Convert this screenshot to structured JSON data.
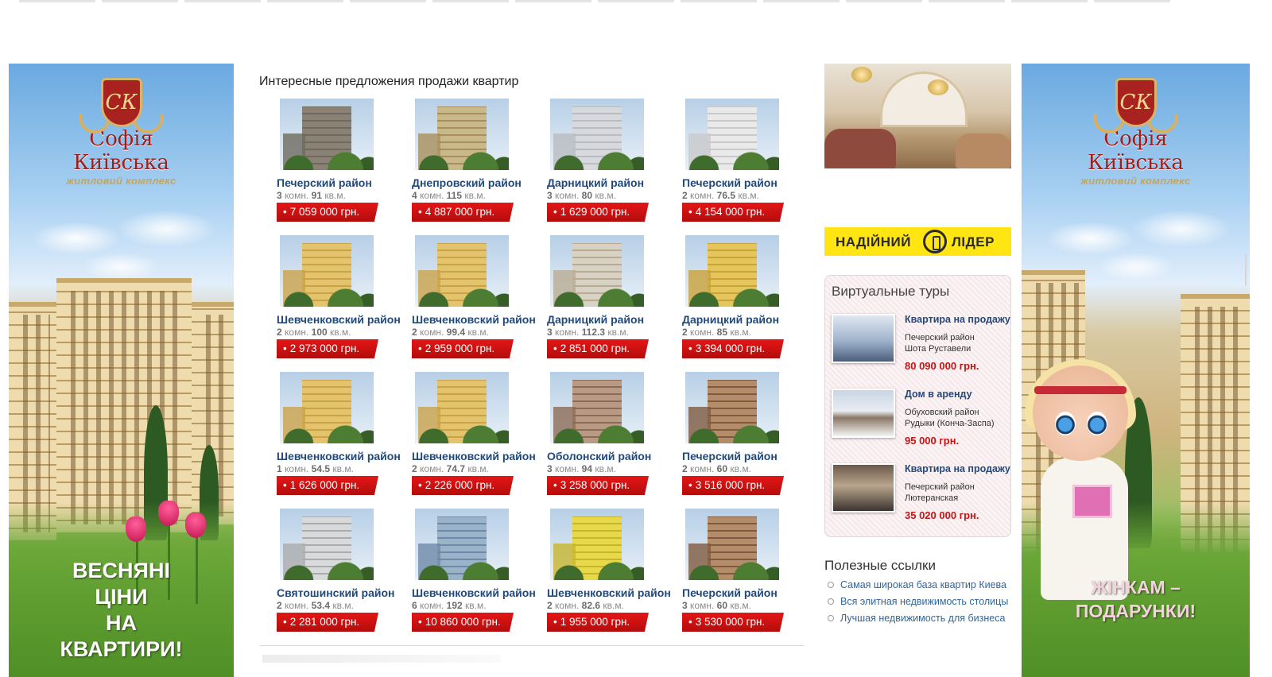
{
  "section_title": "Интересные предложения продажи квартир",
  "listings": [
    {
      "district": "Печерский район",
      "rooms": "3",
      "rooms_label": "комн.",
      "area": "91",
      "area_unit": "кв.м.",
      "price": "7 059 000 грн."
    },
    {
      "district": "Днепровский район",
      "rooms": "4",
      "rooms_label": "комн.",
      "area": "115",
      "area_unit": "кв.м.",
      "price": "4 887 000 грн."
    },
    {
      "district": "Дарницкий район",
      "rooms": "3",
      "rooms_label": "комн.",
      "area": "80",
      "area_unit": "кв.м.",
      "price": "1 629 000 грн."
    },
    {
      "district": "Печерский район",
      "rooms": "2",
      "rooms_label": "комн.",
      "area": "76.5",
      "area_unit": "кв.м.",
      "price": "4 154 000 грн."
    },
    {
      "district": "Шевченковский район",
      "rooms": "2",
      "rooms_label": "комн.",
      "area": "100",
      "area_unit": "кв.м.",
      "price": "2 973 000 грн."
    },
    {
      "district": "Шевченковский район",
      "rooms": "2",
      "rooms_label": "комн.",
      "area": "99.4",
      "area_unit": "кв.м.",
      "price": "2 959 000 грн."
    },
    {
      "district": "Дарницкий район",
      "rooms": "3",
      "rooms_label": "комн.",
      "area": "112.3",
      "area_unit": "кв.м.",
      "price": "2 851 000 грн."
    },
    {
      "district": "Дарницкий район",
      "rooms": "2",
      "rooms_label": "комн.",
      "area": "85",
      "area_unit": "кв.м.",
      "price": "3 394 000 грн."
    },
    {
      "district": "Шевченковский район",
      "rooms": "1",
      "rooms_label": "комн.",
      "area": "54.5",
      "area_unit": "кв.м.",
      "price": "1 626 000 грн."
    },
    {
      "district": "Шевченковский район",
      "rooms": "2",
      "rooms_label": "комн.",
      "area": "74.7",
      "area_unit": "кв.м.",
      "price": "2 226 000 грн."
    },
    {
      "district": "Оболонский район",
      "rooms": "3",
      "rooms_label": "комн.",
      "area": "94",
      "area_unit": "кв.м.",
      "price": "3 258 000 грн."
    },
    {
      "district": "Печерский район",
      "rooms": "2",
      "rooms_label": "комн.",
      "area": "60",
      "area_unit": "кв.м.",
      "price": "3 516 000 грн."
    },
    {
      "district": "Святошинский район",
      "rooms": "2",
      "rooms_label": "комн.",
      "area": "53.4",
      "area_unit": "кв.м.",
      "price": "2 281 000 грн."
    },
    {
      "district": "Шевченковский район",
      "rooms": "6",
      "rooms_label": "комн.",
      "area": "192",
      "area_unit": "кв.м.",
      "price": "10 860 000 грн."
    },
    {
      "district": "Шевченковский район",
      "rooms": "2",
      "rooms_label": "комн.",
      "area": "82.6",
      "area_unit": "кв.м.",
      "price": "1 955 000 грн."
    },
    {
      "district": "Печерский район",
      "rooms": "3",
      "rooms_label": "комн.",
      "area": "60",
      "area_unit": "кв.м.",
      "price": "3 530 000 грн."
    }
  ],
  "left_banner": {
    "brand_line1": "Софія",
    "brand_line2": "Київська",
    "brand_sub": "житловий комплекс",
    "crest_text": "СК",
    "cta": [
      "ВЕСНЯНІ",
      "ЦІНИ",
      "НА",
      "КВАРТИРИ!"
    ]
  },
  "right_banner": {
    "brand_line1": "Софія",
    "brand_line2": "Київська",
    "brand_sub": "житловий комплекс",
    "crest_text": "СК",
    "cta": [
      "ЖІНКАМ –",
      "ПОДАРУНКИ!"
    ]
  },
  "leader_banner": {
    "word1": "НАДІЙНИЙ",
    "word2": "ЛІДЕР"
  },
  "tours": {
    "title": "Виртуальные туры",
    "items": [
      {
        "name": "Квартира на продажу",
        "addr1": "Печерский район",
        "addr2": "Шота Руставели",
        "price": "80 090 000 грн."
      },
      {
        "name": "Дом в аренду",
        "addr1": "Обуховский район",
        "addr2": "Рудыки (Конча-Заспа)",
        "price": "95 000 грн."
      },
      {
        "name": "Квартира на продажу",
        "addr1": "Печерский район",
        "addr2": "Лютеранская",
        "price": "35 020 000 грн."
      }
    ]
  },
  "useful_links": {
    "title": "Полезные ссылки",
    "items": [
      "Самая широкая база квартир Киева",
      "Вся элитная недвижимость столицы",
      "Лучшая недвижимость для бизнеса"
    ]
  },
  "colors": {
    "price_red": "#d41212",
    "district_blue": "#23497a",
    "leader_yellow": "#ffe511",
    "tour_price": "#c81313"
  }
}
